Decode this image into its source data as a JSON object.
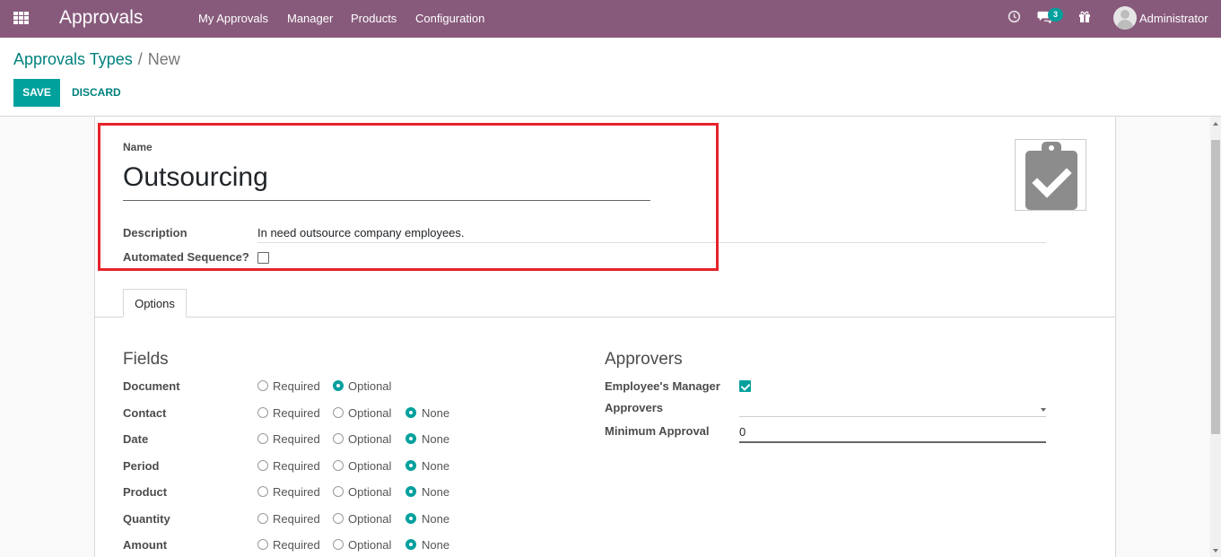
{
  "navbar": {
    "brand": "Approvals",
    "menu": [
      {
        "label": "My Approvals"
      },
      {
        "label": "Manager"
      },
      {
        "label": "Products"
      },
      {
        "label": "Configuration"
      }
    ],
    "icons": {
      "apps": "apps-grid-icon",
      "activity": "clock-icon",
      "messages": "chat-icon",
      "gift": "gift-icon"
    },
    "message_count": "3",
    "user": "Administrator",
    "bg_color": "#875a7b"
  },
  "breadcrumb": {
    "parent": "Approvals Types",
    "separator": "/",
    "current": "New"
  },
  "buttons": {
    "save": "SAVE",
    "discard": "DISCARD"
  },
  "form": {
    "name_label": "Name",
    "name_value": "Outsourcing",
    "description_label": "Description",
    "description_value": "In need outsource company employees.",
    "automated_sequence_label": "Automated Sequence?",
    "automated_sequence_checked": false,
    "image_icon": "clipboard-check-icon"
  },
  "tabs": [
    {
      "label": "Options",
      "active": true
    }
  ],
  "fields_section": {
    "title": "Fields",
    "options": {
      "required": "Required",
      "optional": "Optional",
      "none": "None"
    },
    "rows": [
      {
        "label": "Document",
        "selected": "optional",
        "has_none": false
      },
      {
        "label": "Contact",
        "selected": "none",
        "has_none": true
      },
      {
        "label": "Date",
        "selected": "none",
        "has_none": true
      },
      {
        "label": "Period",
        "selected": "none",
        "has_none": true
      },
      {
        "label": "Product",
        "selected": "none",
        "has_none": true
      },
      {
        "label": "Quantity",
        "selected": "none",
        "has_none": true
      },
      {
        "label": "Amount",
        "selected": "none",
        "has_none": true
      }
    ]
  },
  "approvers_section": {
    "title": "Approvers",
    "employees_manager_label": "Employee's Manager",
    "employees_manager_checked": true,
    "approvers_label": "Approvers",
    "approvers_value": "",
    "minimum_approval_label": "Minimum Approval",
    "minimum_approval_value": "0"
  },
  "colors": {
    "accent": "#00a09d",
    "link": "#00827e",
    "highlight": "#e5232b"
  }
}
